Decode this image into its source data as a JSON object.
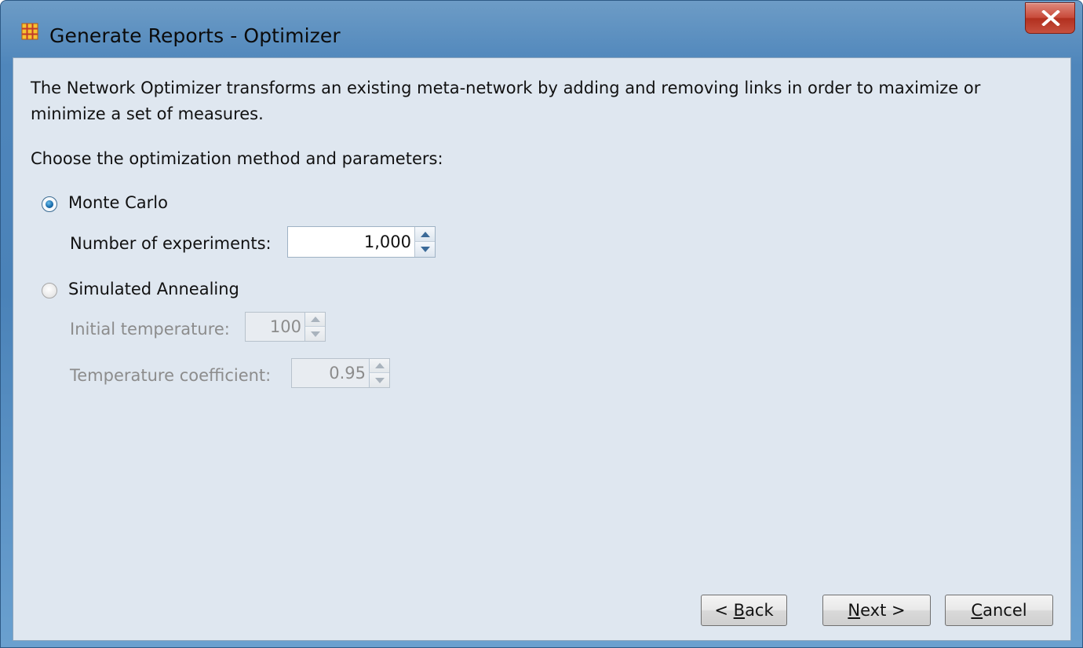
{
  "window": {
    "title": "Generate Reports - Optimizer"
  },
  "main": {
    "description": "The Network Optimizer transforms an existing meta-network by adding and removing links in order to maximize or minimize a set of measures.",
    "prompt": "Choose the optimization method and parameters:"
  },
  "monte_carlo": {
    "label": "Monte Carlo",
    "selected": true,
    "experiments_label": "Number of experiments:",
    "experiments_value": "1,000"
  },
  "simulated_annealing": {
    "label": "Simulated Annealing",
    "selected": false,
    "initial_temp_label": "Initial temperature:",
    "initial_temp_value": "100",
    "temp_coeff_label": "Temperature coefficient:",
    "temp_coeff_value": "0.95"
  },
  "buttons": {
    "back_prefix": "< ",
    "back_mnemonic": "B",
    "back_rest": "ack",
    "next_mnemonic": "N",
    "next_rest": "ext >",
    "cancel_mnemonic": "C",
    "cancel_rest": "ancel"
  },
  "colors": {
    "titlebar": "#4f86bb",
    "content_bg": "#dfe7f0",
    "close_button": "#c84b3b",
    "disabled_text": "#8c8c8c"
  },
  "icons": {
    "app": "network-grid-icon",
    "close": "close-x-icon"
  }
}
